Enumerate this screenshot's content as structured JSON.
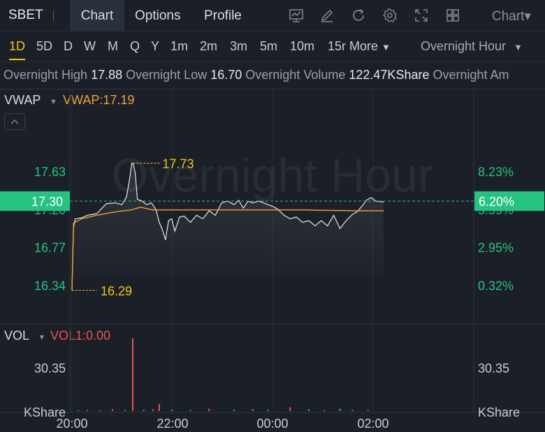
{
  "header": {
    "ticker": "SBET",
    "tabs": [
      "Chart",
      "Options",
      "Profile"
    ],
    "active_tab": 0,
    "chart_type_label": "Chart"
  },
  "periods": {
    "items": [
      "1D",
      "5D",
      "D",
      "W",
      "M",
      "Q",
      "Y",
      "1m",
      "2m",
      "3m",
      "5m",
      "10m",
      "15r",
      "More"
    ],
    "active": "1D",
    "session_label": "Overnight Hour"
  },
  "stats": {
    "high_label": "Overnight High",
    "high": "17.88",
    "low_label": "Overnight Low",
    "low": "16.70",
    "volume_label": "Overnight Volume",
    "volume": "122.47KShare",
    "amount_label": "Overnight Am"
  },
  "indicator": {
    "name": "VWAP",
    "value_label": "VWAP:17.19",
    "watermark": "Overnight Hour"
  },
  "volume_panel": {
    "name": "VOL",
    "value_label": "VOL1:0.00",
    "level_left": "30.35",
    "level_right": "30.35",
    "unit_left": "KShare",
    "unit_right": "KShare"
  },
  "colors": {
    "up": "#26c281",
    "down": "#ef5350",
    "vwap": "#f0a33a",
    "price": "#e6e8ec",
    "highlight": "#f5c518"
  },
  "chart_data": {
    "type": "line",
    "x_ticks": [
      "20:00",
      "22:00",
      "00:00",
      "02:00"
    ],
    "y_left_ticks": [
      "17.63",
      "17.20",
      "16.77",
      "16.34"
    ],
    "y_right_ticks": [
      "8.23%",
      "5.59%",
      "2.95%",
      "0.32%"
    ],
    "ylim": [
      16.2,
      17.8
    ],
    "current_price": "17.30",
    "current_change": "6.20%",
    "annotations": [
      {
        "label": "17.73",
        "x": 0.196,
        "y": 17.73
      },
      {
        "label": "16.29",
        "x": 0.0,
        "y": 16.29
      }
    ],
    "series": [
      {
        "name": "Price",
        "x": [
          0.0,
          0.005,
          0.01,
          0.03,
          0.05,
          0.08,
          0.11,
          0.14,
          0.16,
          0.175,
          0.185,
          0.192,
          0.197,
          0.203,
          0.21,
          0.225,
          0.24,
          0.255,
          0.27,
          0.28,
          0.29,
          0.3,
          0.31,
          0.32,
          0.33,
          0.345,
          0.36,
          0.38,
          0.4,
          0.42,
          0.44,
          0.46,
          0.48,
          0.5,
          0.52,
          0.535,
          0.55,
          0.565,
          0.58,
          0.6,
          0.615,
          0.63,
          0.645,
          0.66,
          0.68,
          0.7,
          0.72,
          0.74,
          0.76,
          0.78,
          0.8,
          0.82,
          0.84,
          0.86,
          0.88,
          0.9,
          0.915,
          0.93,
          0.945,
          0.96,
          0.975,
          1.0
        ],
        "values": [
          16.29,
          17.0,
          17.1,
          17.11,
          17.14,
          17.16,
          17.27,
          17.28,
          17.26,
          17.35,
          17.55,
          17.73,
          17.72,
          17.62,
          17.32,
          17.3,
          17.26,
          17.28,
          17.2,
          17.06,
          16.98,
          16.86,
          17.08,
          17.1,
          16.96,
          17.12,
          17.13,
          17.06,
          17.14,
          17.1,
          17.19,
          17.14,
          17.28,
          17.3,
          17.26,
          17.31,
          17.22,
          17.3,
          17.28,
          17.3,
          17.28,
          17.26,
          17.24,
          17.21,
          17.14,
          17.1,
          17.12,
          17.06,
          17.08,
          17.02,
          17.08,
          17.02,
          17.14,
          16.99,
          17.08,
          17.15,
          17.18,
          17.24,
          17.31,
          17.34,
          17.3,
          17.29
        ]
      },
      {
        "name": "VWAP",
        "x": [
          0.0,
          0.005,
          0.03,
          0.08,
          0.14,
          0.19,
          0.22,
          0.26,
          0.35,
          0.45,
          0.6,
          0.75,
          0.9,
          1.0
        ],
        "values": [
          16.29,
          17.05,
          17.1,
          17.14,
          17.18,
          17.2,
          17.23,
          17.2,
          17.2,
          17.2,
          17.2,
          17.2,
          17.19,
          17.19
        ]
      },
      {
        "name": "VOL1",
        "x": [
          0.02,
          0.05,
          0.09,
          0.13,
          0.17,
          0.195,
          0.23,
          0.26,
          0.28,
          0.32,
          0.38,
          0.44,
          0.52,
          0.58,
          0.63,
          0.7,
          0.76,
          0.81,
          0.86,
          0.9,
          0.95
        ],
        "values": [
          0.6,
          0.8,
          0.5,
          1.2,
          0.7,
          51.0,
          0.9,
          1.1,
          5.0,
          1.0,
          0.8,
          1.6,
          1.0,
          1.4,
          0.9,
          2.6,
          1.1,
          0.8,
          1.7,
          0.9,
          0.7
        ],
        "up": [
          true,
          false,
          true,
          false,
          true,
          false,
          true,
          false,
          false,
          true,
          true,
          false,
          true,
          false,
          true,
          false,
          true,
          false,
          true,
          false,
          true
        ]
      }
    ]
  }
}
